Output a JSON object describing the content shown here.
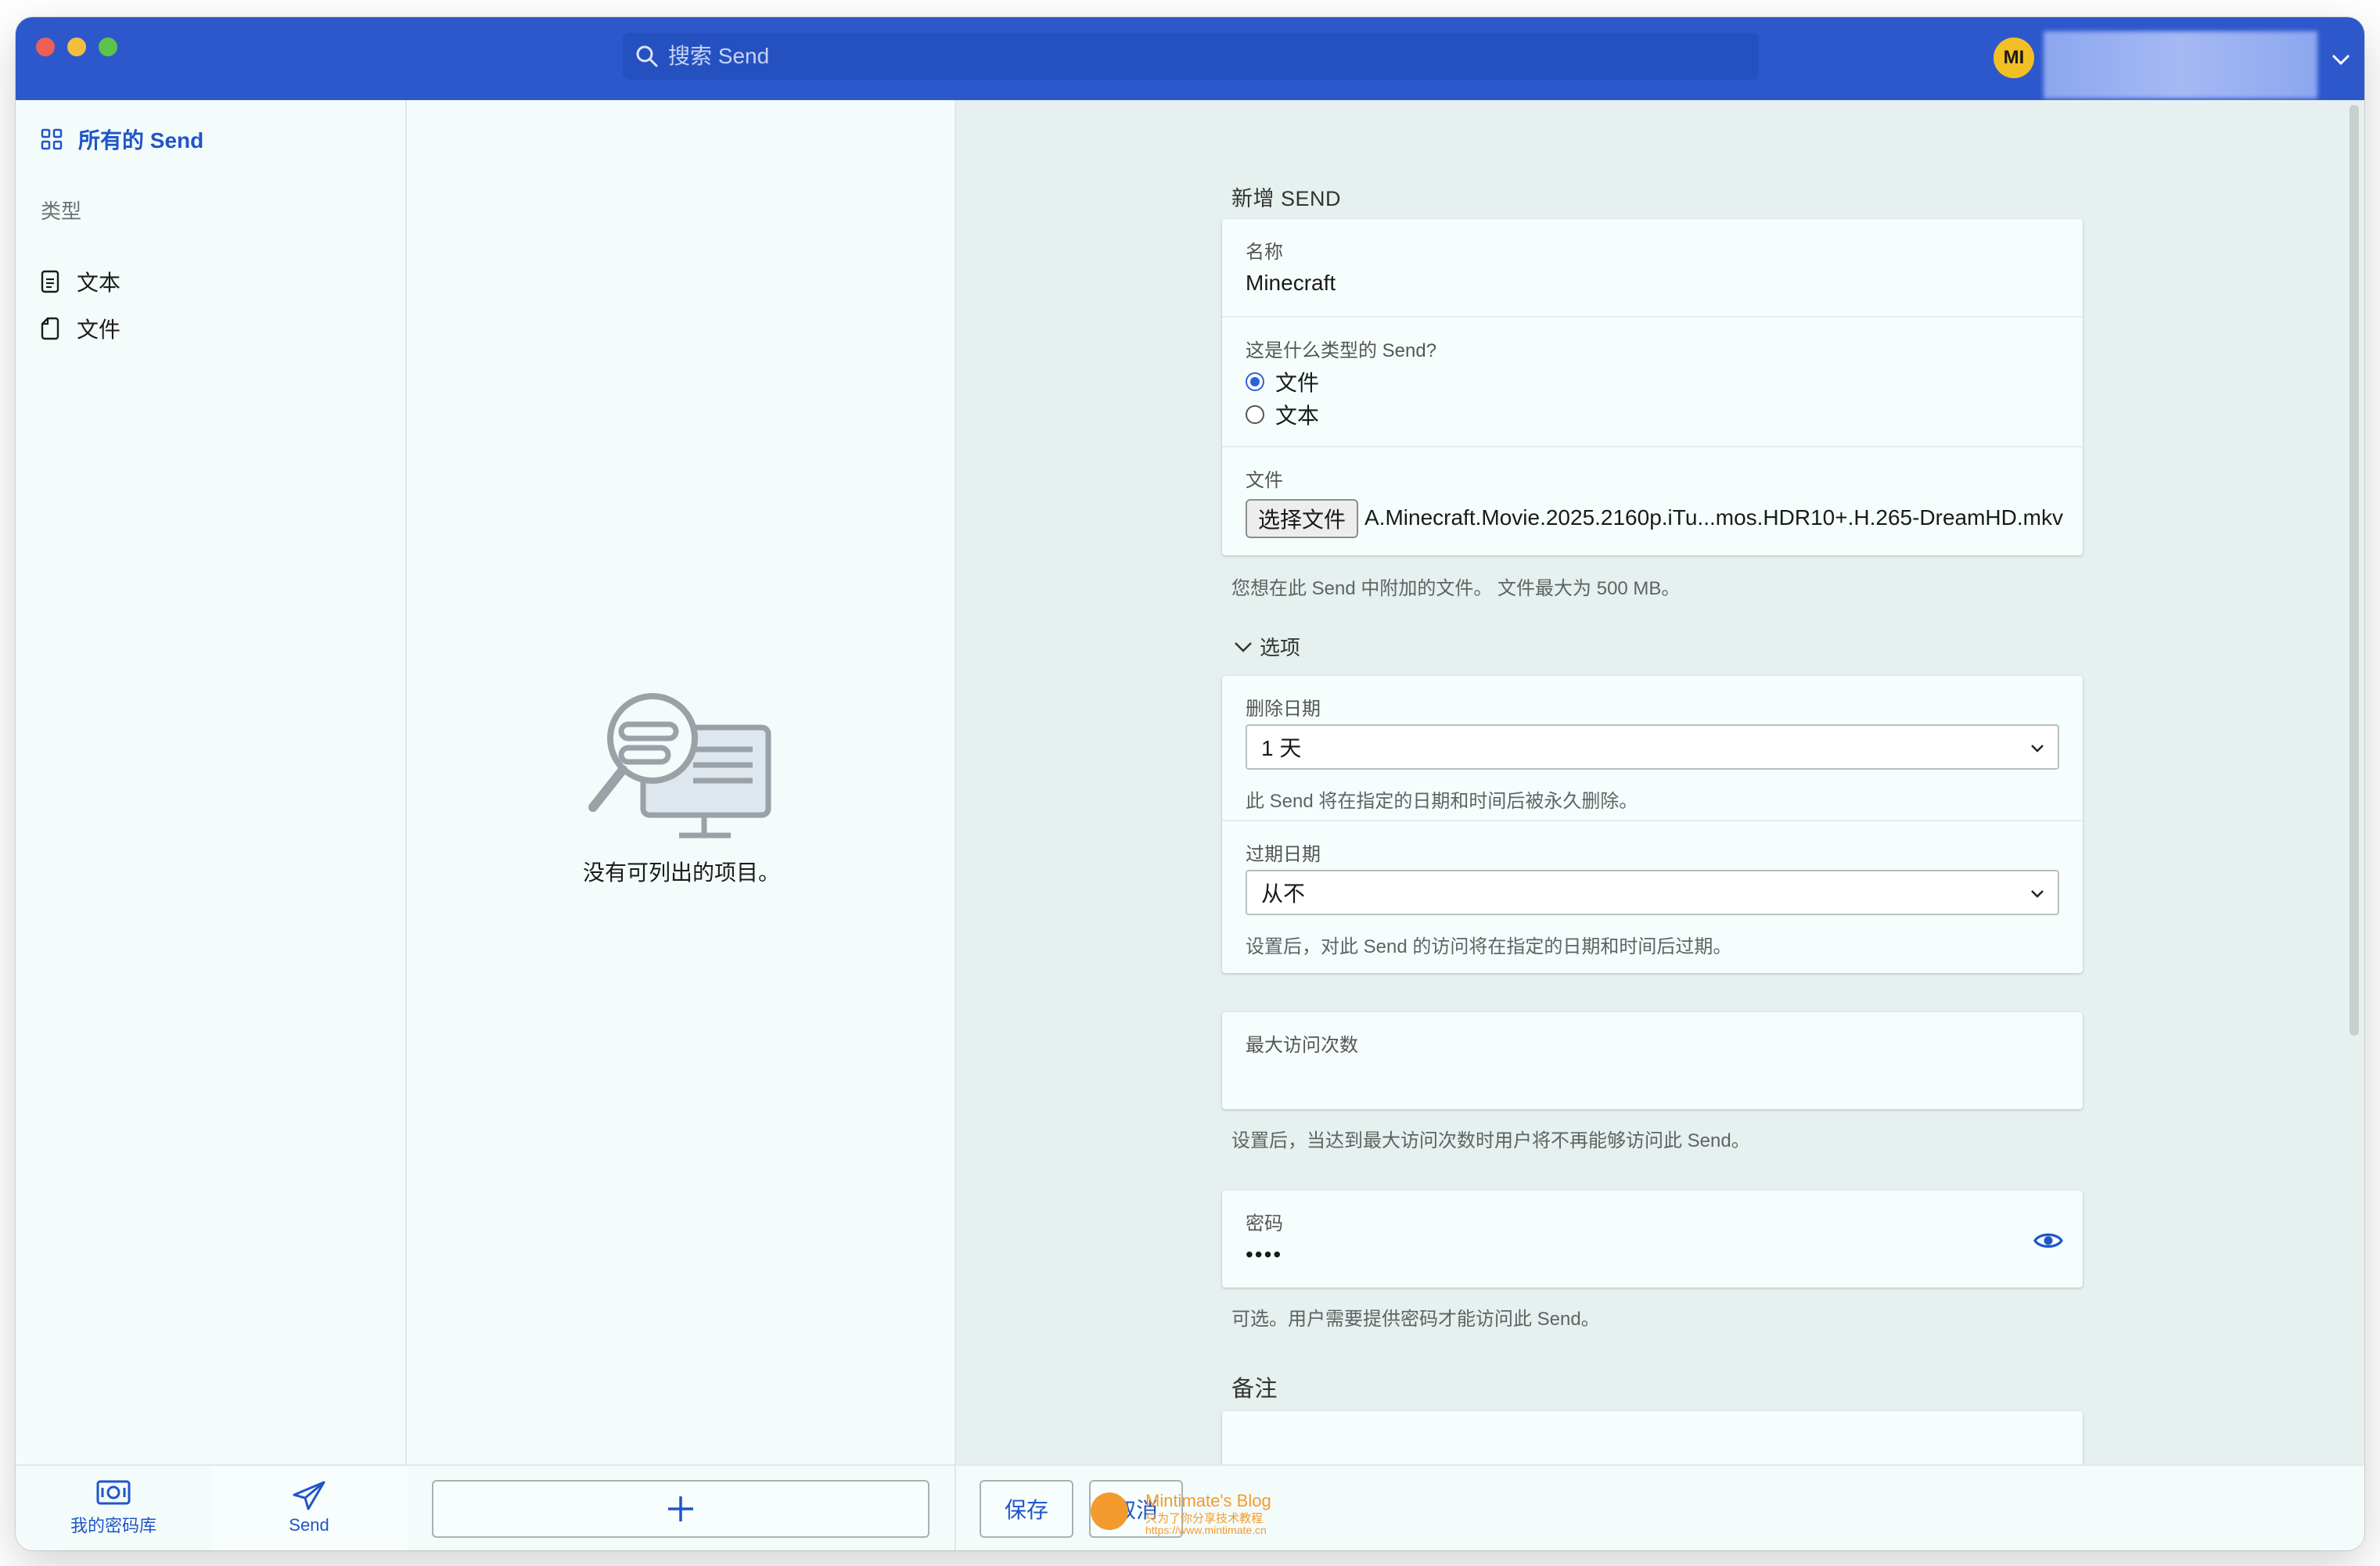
{
  "search": {
    "placeholder": "搜索 Send"
  },
  "account": {
    "initials": "MI"
  },
  "sidebar": {
    "all_label": "所有的 Send",
    "types_label": "类型",
    "items": [
      {
        "label": "文本",
        "icon": "text-document-icon"
      },
      {
        "label": "文件",
        "icon": "file-document-icon"
      }
    ],
    "bottom_nav": [
      {
        "label": "我的密码库",
        "icon": "vault-icon"
      },
      {
        "label": "Send",
        "icon": "send-paper-plane-icon"
      }
    ]
  },
  "list": {
    "empty_text": "没有可列出的项目。"
  },
  "form": {
    "section_title": "新增 SEND",
    "name_label": "名称",
    "name_value": "Minecraft",
    "type_question": "这是什么类型的 Send?",
    "type_options": [
      {
        "label": "文件",
        "selected": true
      },
      {
        "label": "文本",
        "selected": false
      }
    ],
    "file_label": "文件",
    "choose_file_button": "选择文件",
    "file_name": "A.Minecraft.Movie.2025.2160p.iTu...mos.HDR10+.H.265-DreamHD.mkv",
    "file_help": "您想在此 Send 中附加的文件。 文件最大为 500 MB。",
    "options_label": "选项",
    "deletion_label": "删除日期",
    "deletion_value": "1 天",
    "deletion_help": "此 Send 将在指定的日期和时间后被永久删除。",
    "expiration_label": "过期日期",
    "expiration_value": "从不",
    "expiration_help": "设置后，对此 Send 的访问将在指定的日期和时间后过期。",
    "max_access_label": "最大访问次数",
    "max_access_value": "",
    "max_access_help": "设置后，当达到最大访问次数时用户将不再能够访问此 Send。",
    "password_label": "密码",
    "password_value": "••••",
    "password_help": "可选。用户需要提供密码才能访问此 Send。",
    "notes_label": "备注"
  },
  "footer": {
    "save_label": "保存",
    "cancel_label": "取消",
    "watermark_title": "Mintimate's Blog",
    "watermark_sub": "只为了你分享技术教程",
    "watermark_url": "https://www.mintimate.cn"
  },
  "colors": {
    "titlebar": "#2d58cc",
    "accent": "#1f55c9",
    "avatar": "#f2c025",
    "background": "#f4fcfb",
    "detail_background": "#e6f0ee"
  }
}
